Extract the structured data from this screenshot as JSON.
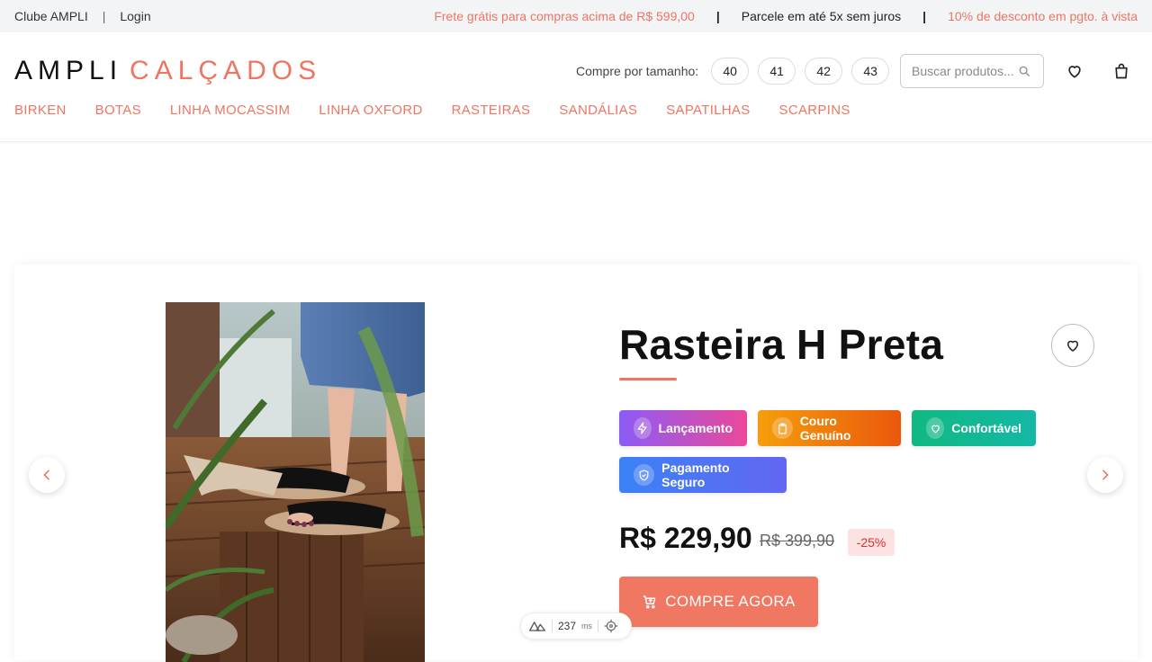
{
  "topbar": {
    "club": "Clube AMPLI",
    "separator": "|",
    "login": "Login",
    "promo_shipping": "Frete grátis para compras acima de R$ 599,00",
    "bar1": "|",
    "installments": "Parcele em até 5x sem juros",
    "bar2": "|",
    "promo_discount": "10% de desconto em pgto. à vista"
  },
  "header": {
    "logo_part1": "AMPLI",
    "logo_part2": "CALÇADOS",
    "size_label": "Compre por tamanho:",
    "sizes": [
      "40",
      "41",
      "42",
      "43"
    ],
    "search_placeholder": "Buscar produtos...",
    "nav": [
      "BIRKEN",
      "BOTAS",
      "LINHA MOCASSIM",
      "LINHA OXFORD",
      "RASTEIRAS",
      "SANDÁLIAS",
      "SAPATILHAS",
      "SCARPINS"
    ]
  },
  "product": {
    "title": "Rasteira H Preta",
    "badges": [
      {
        "label": "Lançamento",
        "icon": "lightning-icon",
        "color_start": "#8b5cf6",
        "color_end": "#ec4899"
      },
      {
        "label": "Couro Genuíno",
        "icon": "clipboard-icon",
        "color_start": "#f59e0b",
        "color_end": "#ea580c"
      },
      {
        "label": "Confortável",
        "icon": "heart-icon",
        "color_start": "#10b981",
        "color_end": "#14b8a6"
      },
      {
        "label": "Pagamento Seguro",
        "icon": "shield-check-icon",
        "color_start": "#3b82f6",
        "color_end": "#6366f1"
      }
    ],
    "price": "R$ 229,90",
    "old_price": "R$ 399,90",
    "discount": "-25%",
    "buy_label": "COMPRE AGORA"
  },
  "perf": {
    "value": "237",
    "unit": "ms"
  },
  "colors": {
    "accent": "#ee7561",
    "buy_button": "#f07862",
    "discount_bg": "#fde2e2",
    "discount_text": "#d93030"
  }
}
